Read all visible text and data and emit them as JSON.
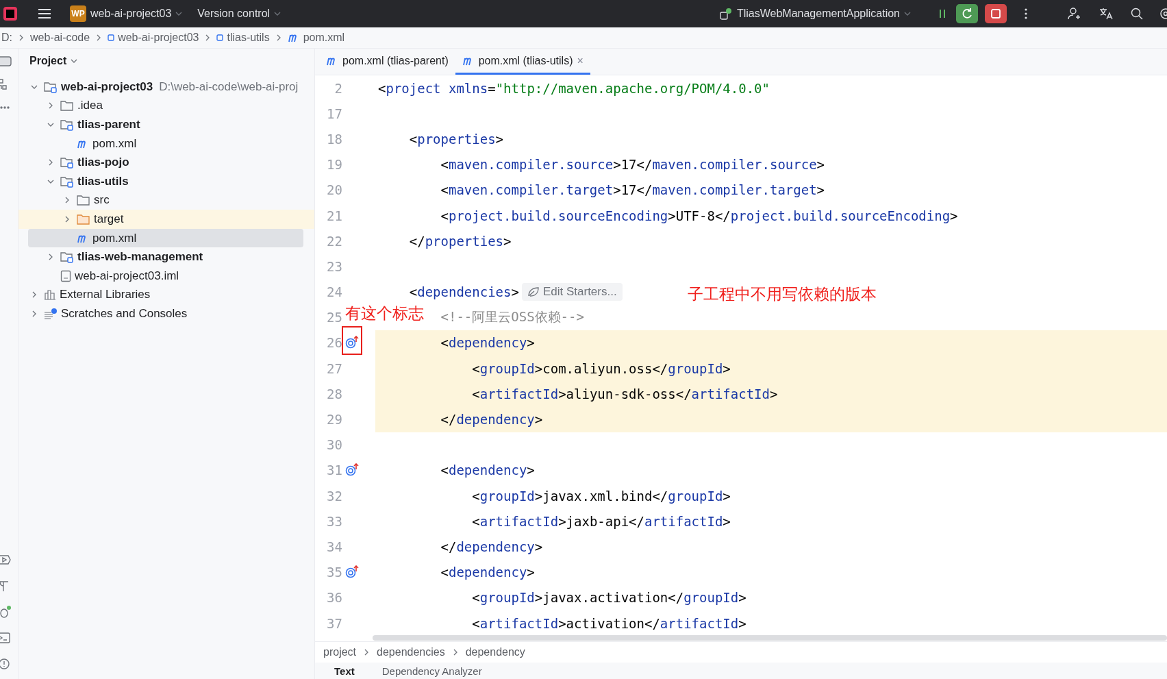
{
  "title_bar": {
    "logo": "WP",
    "project": "web-ai-project03",
    "vcs": "Version control",
    "run_config": "TliasWebManagementApplication"
  },
  "breadcrumb": [
    "D:",
    "web-ai-code",
    "web-ai-project03",
    "tlias-utils",
    "pom.xml"
  ],
  "project_panel": {
    "title": "Project",
    "tree": [
      {
        "label": "web-ai-project03",
        "hint": "D:\\web-ai-code\\web-ai-proj",
        "kind": "module",
        "expanded": true,
        "selected": false,
        "children": [
          {
            "label": ".idea",
            "kind": "folder",
            "expanded": false,
            "selected": false
          },
          {
            "label": "tlias-parent",
            "kind": "module",
            "expanded": true,
            "selected": false,
            "children": [
              {
                "label": "pom.xml",
                "kind": "pom",
                "selected": false
              }
            ]
          },
          {
            "label": "tlias-pojo",
            "kind": "module",
            "expanded": false,
            "selected": false
          },
          {
            "label": "tlias-utils",
            "kind": "module",
            "expanded": true,
            "selected": false,
            "children": [
              {
                "label": "src",
                "kind": "folder",
                "expanded": false,
                "selected": false
              },
              {
                "label": "target",
                "kind": "excluded",
                "expanded": false,
                "selected": false
              },
              {
                "label": "pom.xml",
                "kind": "pom",
                "selected": true
              }
            ]
          },
          {
            "label": "tlias-web-management",
            "kind": "module",
            "expanded": false,
            "selected": false
          },
          {
            "label": "web-ai-project03.iml",
            "kind": "file",
            "selected": false
          }
        ]
      },
      {
        "label": "External Libraries",
        "kind": "libraries",
        "expanded": false,
        "selected": false
      },
      {
        "label": "Scratches and Consoles",
        "kind": "scratches",
        "expanded": false,
        "selected": false
      }
    ]
  },
  "editor_tabs": [
    {
      "label": "pom.xml (tlias-parent)",
      "selected": false
    },
    {
      "label": "pom.xml (tlias-utils)",
      "selected": true,
      "close": "×"
    }
  ],
  "code_lines": [
    {
      "number": "2",
      "marker": false,
      "highlighted": false,
      "segments": [
        {
          "kind": "punct",
          "text": "<"
        },
        {
          "kind": "tag",
          "text": "project "
        },
        {
          "kind": "attr",
          "text": "xmlns"
        },
        {
          "kind": "punct",
          "text": "="
        },
        {
          "kind": "string",
          "text": "\"http://maven.apache.org/POM/4.0.0\""
        }
      ]
    },
    {
      "number": "17",
      "marker": false,
      "highlighted": false
    },
    {
      "number": "18",
      "marker": false,
      "highlighted": false,
      "segments": [
        {
          "kind": "punct",
          "text": "    <"
        },
        {
          "kind": "tag",
          "text": "properties"
        },
        {
          "kind": "punct",
          "text": ">"
        }
      ]
    },
    {
      "number": "19",
      "marker": false,
      "highlighted": false,
      "segments": [
        {
          "kind": "punct",
          "text": "        <"
        },
        {
          "kind": "tag",
          "text": "maven.compiler.source"
        },
        {
          "kind": "punct",
          "text": ">17</"
        },
        {
          "kind": "tag",
          "text": "maven.compiler.source"
        },
        {
          "kind": "punct",
          "text": ">"
        }
      ]
    },
    {
      "number": "20",
      "marker": false,
      "highlighted": false,
      "segments": [
        {
          "kind": "punct",
          "text": "        <"
        },
        {
          "kind": "tag",
          "text": "maven.compiler.target"
        },
        {
          "kind": "punct",
          "text": ">17</"
        },
        {
          "kind": "tag",
          "text": "maven.compiler.target"
        },
        {
          "kind": "punct",
          "text": ">"
        }
      ]
    },
    {
      "number": "21",
      "marker": false,
      "highlighted": false,
      "segments": [
        {
          "kind": "punct",
          "text": "        <"
        },
        {
          "kind": "tag",
          "text": "project.build.sourceEncoding"
        },
        {
          "kind": "punct",
          "text": ">UTF-8</"
        },
        {
          "kind": "tag",
          "text": "project.build.sourceEncoding"
        },
        {
          "kind": "punct",
          "text": ">"
        }
      ]
    },
    {
      "number": "22",
      "marker": false,
      "highlighted": false,
      "segments": [
        {
          "kind": "punct",
          "text": "    </"
        },
        {
          "kind": "tag",
          "text": "properties"
        },
        {
          "kind": "punct",
          "text": ">"
        }
      ]
    },
    {
      "number": "23",
      "marker": false,
      "highlighted": false
    },
    {
      "number": "24",
      "marker": false,
      "highlighted": false,
      "segments": [
        {
          "kind": "punct",
          "text": "    <"
        },
        {
          "kind": "tag",
          "text": "dependencies"
        },
        {
          "kind": "punct",
          "text": ">"
        }
      ],
      "inlay": "Edit Starters..."
    },
    {
      "number": "25",
      "marker": false,
      "highlighted": false,
      "segments": [
        {
          "kind": "comment",
          "text": "        <!--阿里云OSS依赖-->"
        }
      ]
    },
    {
      "number": "26",
      "marker": true,
      "highlighted": true,
      "segments": [
        {
          "kind": "punct",
          "text": "        <"
        },
        {
          "kind": "tag",
          "text": "dependency"
        },
        {
          "kind": "punct",
          "text": ">"
        }
      ]
    },
    {
      "number": "27",
      "marker": false,
      "highlighted": true,
      "segments": [
        {
          "kind": "punct",
          "text": "            <"
        },
        {
          "kind": "tag",
          "text": "groupId"
        },
        {
          "kind": "punct",
          "text": ">com.aliyun.oss</"
        },
        {
          "kind": "tag",
          "text": "groupId"
        },
        {
          "kind": "punct",
          "text": ">"
        }
      ]
    },
    {
      "number": "28",
      "marker": false,
      "highlighted": true,
      "segments": [
        {
          "kind": "punct",
          "text": "            <"
        },
        {
          "kind": "tag",
          "text": "artifactId"
        },
        {
          "kind": "punct",
          "text": ">aliyun-sdk-oss</"
        },
        {
          "kind": "tag",
          "text": "artifactId"
        },
        {
          "kind": "punct",
          "text": ">"
        }
      ]
    },
    {
      "number": "29",
      "marker": false,
      "highlighted": true,
      "segments": [
        {
          "kind": "punct",
          "text": "        </"
        },
        {
          "kind": "tag",
          "text": "dependency"
        },
        {
          "kind": "punct",
          "text": ">"
        }
      ]
    },
    {
      "number": "30",
      "marker": false,
      "highlighted": false
    },
    {
      "number": "31",
      "marker": true,
      "highlighted": false,
      "segments": [
        {
          "kind": "punct",
          "text": "        <"
        },
        {
          "kind": "tag",
          "text": "dependency"
        },
        {
          "kind": "punct",
          "text": ">"
        }
      ]
    },
    {
      "number": "32",
      "marker": false,
      "highlighted": false,
      "segments": [
        {
          "kind": "punct",
          "text": "            <"
        },
        {
          "kind": "tag",
          "text": "groupId"
        },
        {
          "kind": "punct",
          "text": ">javax.xml.bind</"
        },
        {
          "kind": "tag",
          "text": "groupId"
        },
        {
          "kind": "punct",
          "text": ">"
        }
      ]
    },
    {
      "number": "33",
      "marker": false,
      "highlighted": false,
      "segments": [
        {
          "kind": "punct",
          "text": "            <"
        },
        {
          "kind": "tag",
          "text": "artifactId"
        },
        {
          "kind": "punct",
          "text": ">jaxb-api</"
        },
        {
          "kind": "tag",
          "text": "artifactId"
        },
        {
          "kind": "punct",
          "text": ">"
        }
      ]
    },
    {
      "number": "34",
      "marker": false,
      "highlighted": false,
      "segments": [
        {
          "kind": "punct",
          "text": "        </"
        },
        {
          "kind": "tag",
          "text": "dependency"
        },
        {
          "kind": "punct",
          "text": ">"
        }
      ]
    },
    {
      "number": "35",
      "marker": true,
      "highlighted": false,
      "segments": [
        {
          "kind": "punct",
          "text": "        <"
        },
        {
          "kind": "tag",
          "text": "dependency"
        },
        {
          "kind": "punct",
          "text": ">"
        }
      ]
    },
    {
      "number": "36",
      "marker": false,
      "highlighted": false,
      "segments": [
        {
          "kind": "punct",
          "text": "            <"
        },
        {
          "kind": "tag",
          "text": "groupId"
        },
        {
          "kind": "punct",
          "text": ">javax.activation</"
        },
        {
          "kind": "tag",
          "text": "groupId"
        },
        {
          "kind": "punct",
          "text": ">"
        }
      ]
    },
    {
      "number": "37",
      "marker": false,
      "highlighted": false,
      "segments": [
        {
          "kind": "punct",
          "text": "            <"
        },
        {
          "kind": "tag",
          "text": "artifactId"
        },
        {
          "kind": "punct",
          "text": ">activation</"
        },
        {
          "kind": "tag",
          "text": "artifactId"
        },
        {
          "kind": "punct",
          "text": ">"
        }
      ]
    }
  ],
  "annotations": {
    "marker_note": "有这个标志",
    "version_note": "子工程中不用写依赖的版本"
  },
  "editor_breadcrumb": [
    "project",
    "dependencies",
    "dependency"
  ],
  "bottom_tabs": [
    {
      "label": "Text",
      "selected": true
    },
    {
      "label": "Dependency Analyzer",
      "selected": false
    }
  ]
}
